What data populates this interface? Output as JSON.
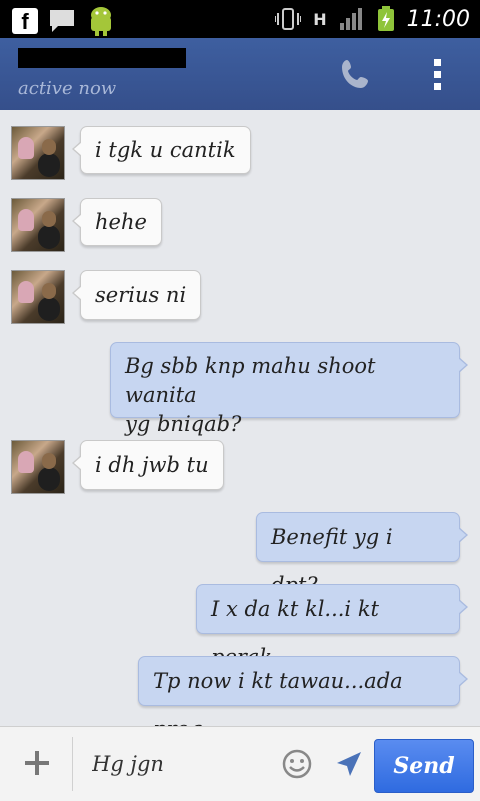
{
  "status_bar": {
    "time": "11:00",
    "icons": [
      "facebook-icon",
      "chat-bubble-icon",
      "android-icon",
      "vibrate-icon",
      "hspa-signal-icon",
      "cell-signal-icon",
      "battery-charging-icon"
    ],
    "network_label": "H"
  },
  "header": {
    "status": "active now",
    "icons": [
      "phone-icon",
      "overflow-menu-icon"
    ]
  },
  "messages": [
    {
      "direction": "in",
      "text": "i tgk u cantik"
    },
    {
      "direction": "in",
      "text": "hehe"
    },
    {
      "direction": "in",
      "text": "serius ni"
    },
    {
      "direction": "out",
      "line1": "Bg sbb knp mahu shoot wanita",
      "line2": "yg bniqab?"
    },
    {
      "direction": "in",
      "text": "i dh jwb tu"
    },
    {
      "direction": "out",
      "text": "Benefit yg i dpt?"
    },
    {
      "direction": "out",
      "text": "I x da kt kl...i kt perak"
    },
    {
      "direction": "out",
      "text": "Tp now i kt tawau...ada prog"
    }
  ],
  "composer": {
    "input_value": "Hg jgn",
    "send_label": "Send",
    "icons": [
      "plus-icon",
      "smiley-icon",
      "location-arrow-icon"
    ]
  },
  "colors": {
    "header_bg": "#3b5998",
    "incoming_bubble": "#fafafa",
    "outgoing_bubble": "#c7d6f1",
    "send_button": "#3f78e6"
  }
}
